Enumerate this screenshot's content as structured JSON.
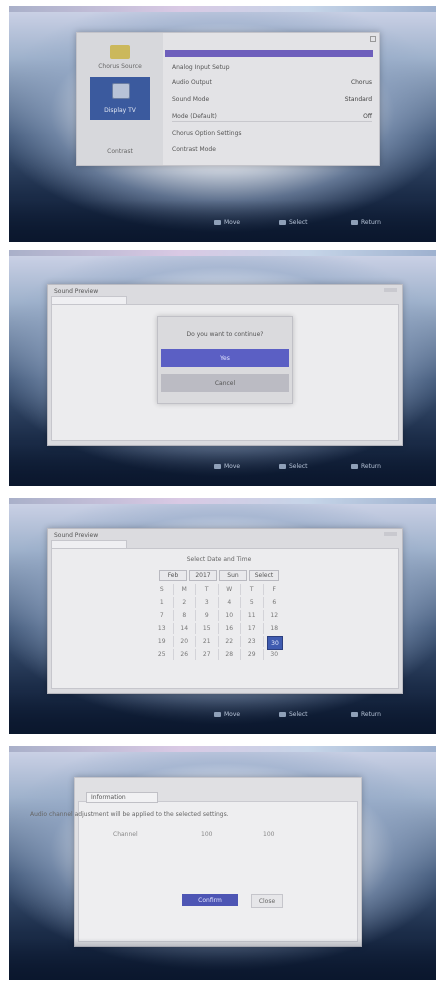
{
  "screen1": {
    "sidebar": [
      "Chorus Source",
      "Display TV",
      "Contrast"
    ],
    "rows": [
      {
        "label": "Analog Input Setup",
        "value": ""
      },
      {
        "label": "Audio Output",
        "value": "Chorus"
      },
      {
        "label": "Sound Mode",
        "value": "Standard"
      },
      {
        "label": "Mode (Default)",
        "value": "Off"
      },
      {
        "label": "Chorus Option Settings",
        "value": ""
      },
      {
        "label": "Contrast Mode",
        "value": ""
      }
    ]
  },
  "screen2": {
    "window_title": "Sound Preview",
    "message": "Do you want to continue?",
    "yes_label": "Yes",
    "no_label": "Cancel"
  },
  "screen3": {
    "window_title": "Sound Preview",
    "header": "Select Date and Time",
    "bar_labels": [
      "Feb",
      "2017",
      "Sun",
      "Select"
    ],
    "rows": [
      [
        "S",
        "M",
        "T",
        "W",
        "T",
        "F"
      ],
      [
        "1",
        "2",
        "3",
        "4",
        "5",
        "6"
      ],
      [
        "7",
        "8",
        "9",
        "10",
        "11",
        "12"
      ],
      [
        "13",
        "14",
        "15",
        "16",
        "17",
        "18"
      ],
      [
        "19",
        "20",
        "21",
        "22",
        "23",
        "24"
      ],
      [
        "25",
        "26",
        "27",
        "28",
        "29",
        "30"
      ]
    ],
    "selected_day": "30"
  },
  "screen4": {
    "tab_label": "Information",
    "message": "Audio channel adjustment will be applied to the selected settings.",
    "sub_left": "Channel",
    "sub_mid": "100",
    "sub_right": "100",
    "ok_label": "Confirm",
    "cancel_label": "Close"
  },
  "footer": {
    "b1": "Move",
    "b2": "Select",
    "b3": "Return"
  }
}
